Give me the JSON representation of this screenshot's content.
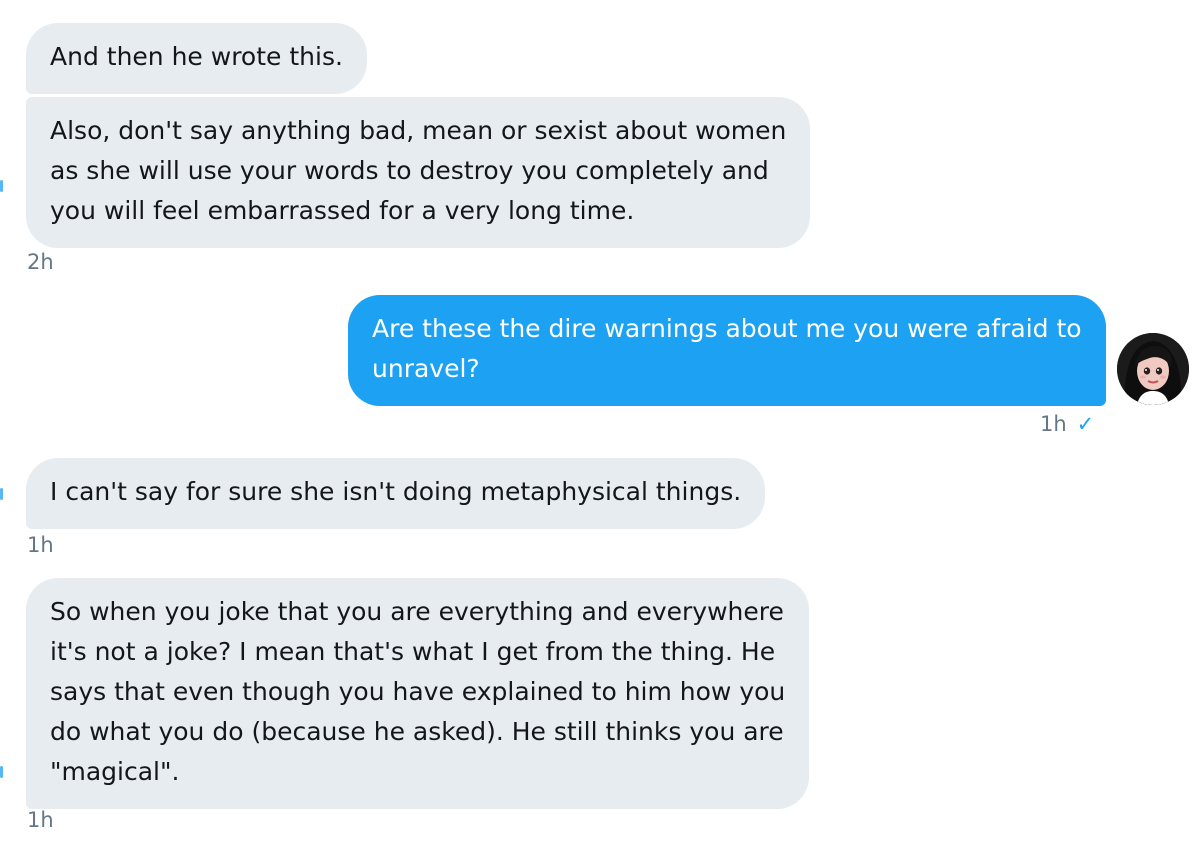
{
  "messages": [
    {
      "direction": "incoming",
      "lines": [
        "And then he wrote this."
      ]
    },
    {
      "direction": "incoming",
      "lines": [
        "Also, don't say anything bad, mean or sexist about women",
        "as she will use your words to destroy you completely and",
        "you will feel embarrassed for a very long time."
      ],
      "timestamp": "2h"
    },
    {
      "direction": "outgoing",
      "lines": [
        "Are these the dire warnings about me you were afraid to",
        "unravel?"
      ],
      "timestamp": "1h",
      "read_icon": "checkmark-icon",
      "check": "✓"
    },
    {
      "direction": "incoming",
      "lines": [
        "I can't say for sure she isn't doing metaphysical things."
      ],
      "timestamp": "1h"
    },
    {
      "direction": "incoming",
      "lines": [
        "So when you joke that you are everything and everywhere",
        "it's not a joke? I mean that's what I get from the thing. He",
        "says that even though you have explained to him how you",
        "do what you do (because he asked). He still thinks you are",
        "\"magical\"."
      ],
      "timestamp": "1h"
    }
  ],
  "colors": {
    "incoming_bubble": "#e6ecf0",
    "outgoing_bubble": "#1da1f2",
    "timestamp": "#657786"
  }
}
